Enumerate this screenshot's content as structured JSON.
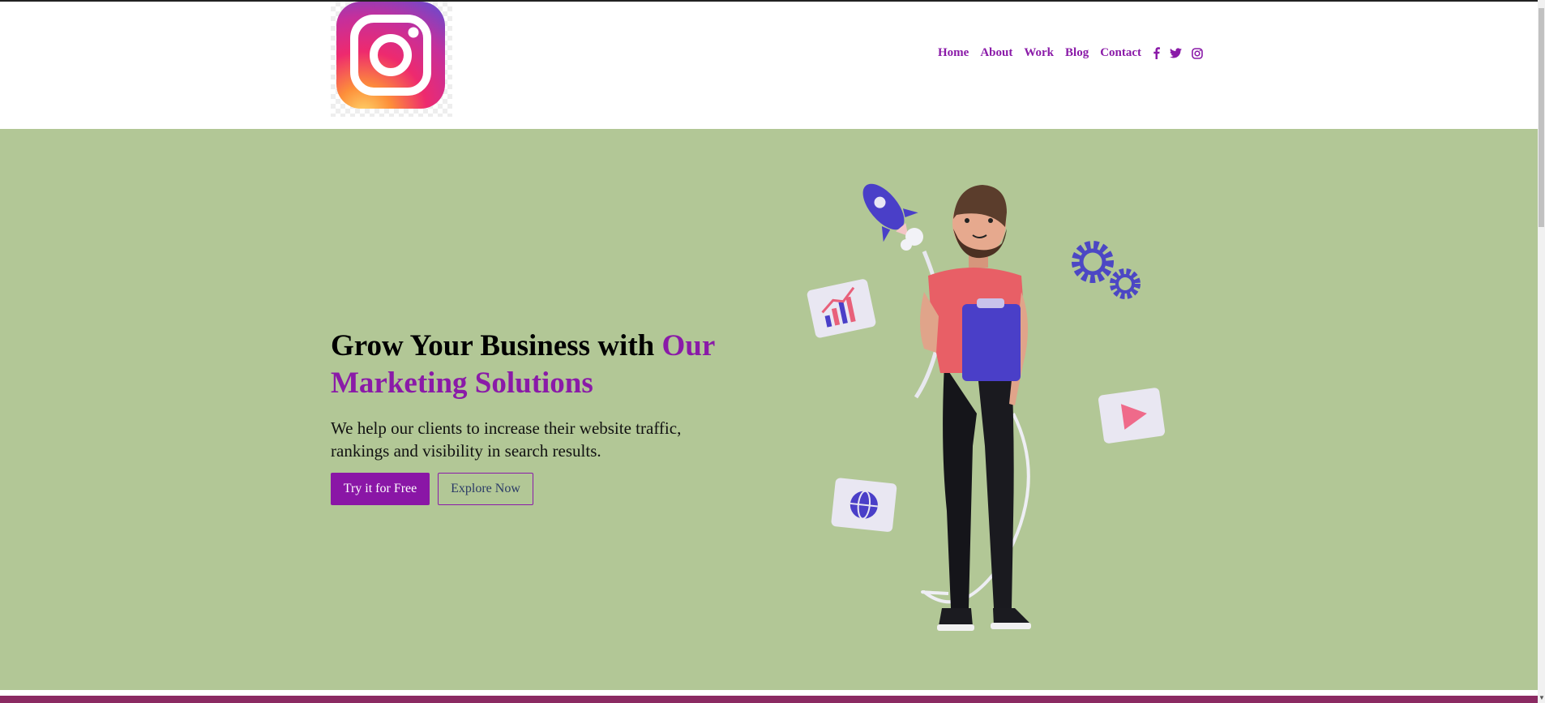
{
  "header": {
    "logo_icon": "instagram-logo",
    "nav": [
      {
        "label": "Home"
      },
      {
        "label": "About"
      },
      {
        "label": "Work"
      },
      {
        "label": "Blog"
      },
      {
        "label": "Contact"
      }
    ],
    "social_icons": [
      "facebook-icon",
      "twitter-icon",
      "instagram-icon"
    ]
  },
  "hero": {
    "headline_part1": "Grow Your Business with ",
    "headline_accent": "Our Marketing Solutions",
    "subtext": "We help our clients to increase their website traffic, rankings and visibility in search results.",
    "cta_primary": "Try it for Free",
    "cta_secondary": "Explore Now",
    "illustration": "3d-man-with-clipboard-rocket-gears-chart-play-globe"
  },
  "colors": {
    "accent": "#8a1aa8",
    "hero_bg": "#b2c796",
    "footer_stripe": "#8b2a62"
  }
}
